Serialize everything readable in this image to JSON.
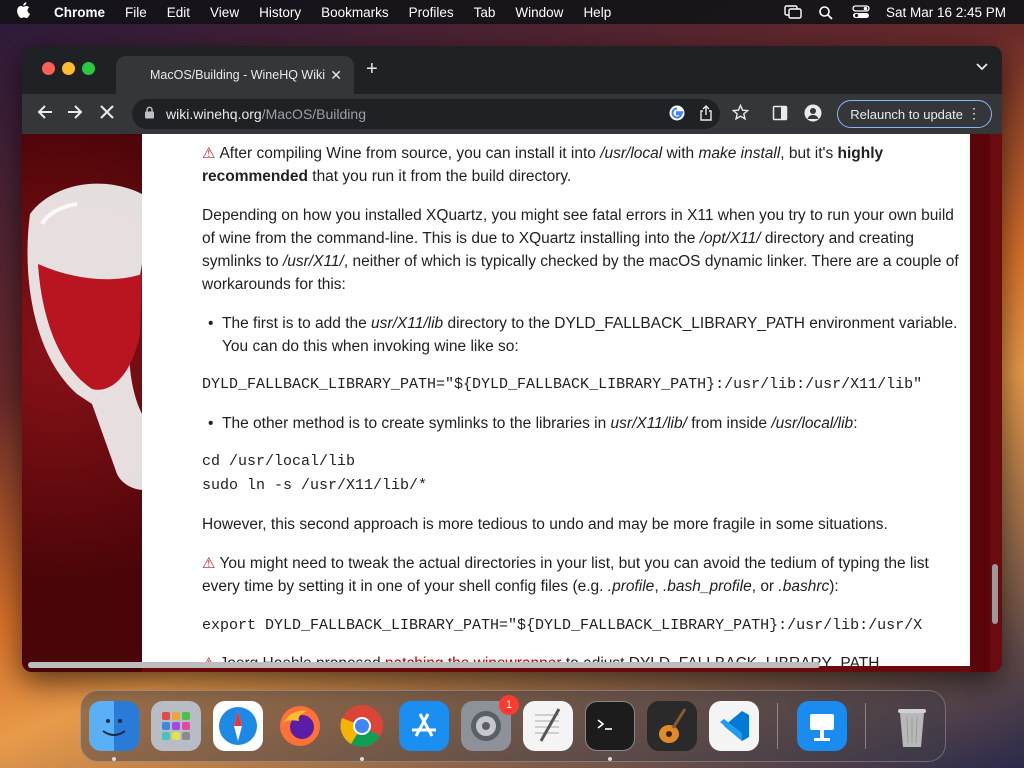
{
  "menubar": {
    "app_name": "Chrome",
    "items": [
      "File",
      "Edit",
      "View",
      "History",
      "Bookmarks",
      "Profiles",
      "Tab",
      "Window",
      "Help"
    ],
    "clock": "Sat Mar 16  2:45 PM"
  },
  "browser": {
    "tab_title": "MacOS/Building - WineHQ Wiki",
    "url_domain": "wiki.winehq.org",
    "url_path": "/MacOS/Building",
    "relaunch_label": "Relaunch to update"
  },
  "article": {
    "p1_a": "After compiling Wine from source, you can install it into ",
    "p1_b": "/usr/local",
    "p1_c": " with ",
    "p1_d": "make install",
    "p1_e": ", but it's ",
    "p1_f": "highly recommended",
    "p1_g": " that you run it from the build directory.",
    "p2_a": "Depending on how you installed XQuartz, you might see fatal errors in X11 when you try to run your own build of wine from the command-line. This is due to XQuartz installing into the ",
    "p2_b": "/opt/X11/",
    "p2_c": " directory and creating symlinks to ",
    "p2_d": "/usr/X11/",
    "p2_e": ", neither of which is typically checked by the macOS dynamic linker. There are a couple of workarounds for this:",
    "b1_a": "The first is to add the ",
    "b1_b": "usr/X11/lib",
    "b1_c": " directory to the DYLD_FALLBACK_LIBRARY_PATH environment variable. You can do this when invoking wine like so:",
    "code1": "DYLD_FALLBACK_LIBRARY_PATH=\"${DYLD_FALLBACK_LIBRARY_PATH}:/usr/lib:/usr/X11/lib\"",
    "b2_a": "The other method is to create symlinks to the libraries in ",
    "b2_b": "usr/X11/lib/",
    "b2_c": " from inside ",
    "b2_d": "/usr/local/lib",
    "b2_e": ":",
    "code2_l1": "cd /usr/local/lib",
    "code2_l2": "sudo ln -s /usr/X11/lib/*",
    "p3": "However, this second approach is more tedious to undo and may be more fragile in some situations.",
    "p4_a": "You might need to tweak the actual directories in your list, but you can avoid the tedium of typing the list every time by setting it in one of your shell config files (e.g. ",
    "p4_b": ".profile",
    "p4_c": ", ",
    "p4_d": ".bash_profile",
    "p4_e": ", or ",
    "p4_f": ".bashrc",
    "p4_g": "):",
    "code3": "export DYLD_FALLBACK_LIBRARY_PATH=\"${DYLD_FALLBACK_LIBRARY_PATH}:/usr/lib:/usr/X",
    "p5_a": "Joerg Hoehle proposed ",
    "p5_link": "patching the winewrapper",
    "p5_b": " to adjust DYLD_FALLBACK_LIBRARY_PATH"
  },
  "dock": {
    "items": [
      "finder-icon",
      "launchpad-icon",
      "safari-icon",
      "firefox-icon",
      "chrome-icon",
      "app-store-icon",
      "system-settings-icon",
      "textedit-icon",
      "terminal-icon",
      "garageband-icon",
      "vscode-icon",
      "keynote-icon",
      "trash-icon"
    ],
    "settings_badge": "1"
  },
  "colors": {
    "menubar_bg": "#141418",
    "chrome_dark": "#202124",
    "chrome_tab": "#35363a",
    "wiki_bg": "#6b0a0f",
    "warning_red": "#b32424",
    "link_red": "#ba0000"
  }
}
